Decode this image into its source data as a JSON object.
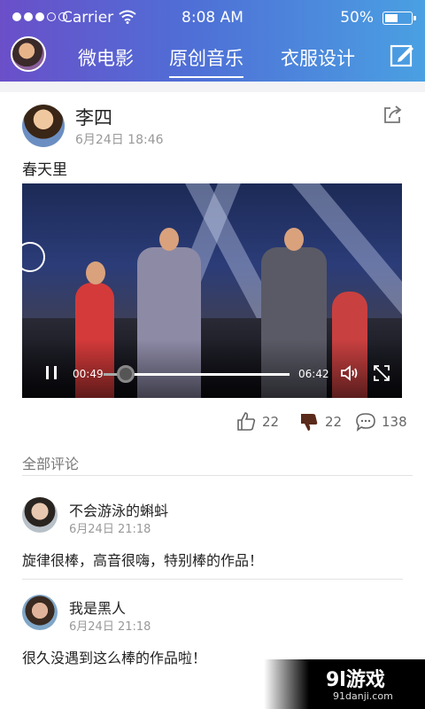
{
  "status_bar": {
    "carrier": "Carrier",
    "time": "8:08 AM",
    "battery": "50%",
    "battery_level": 0.5
  },
  "nav": {
    "tabs": [
      {
        "label": "微电影",
        "active": false
      },
      {
        "label": "原创音乐",
        "active": true
      },
      {
        "label": "衣服设计",
        "active": false
      }
    ],
    "edit_icon": "edit-icon"
  },
  "post": {
    "author": "李四",
    "time": "6月24日 18:46",
    "title": "春天里",
    "share_icon": "share-icon",
    "video": {
      "current_time": "00:49",
      "duration": "06:42",
      "progress": 0.12
    },
    "likes": "22",
    "dislikes": "22",
    "comments": "138"
  },
  "comments_section": {
    "label": "全部评论",
    "items": [
      {
        "name": "不会游泳的蝌蚪",
        "time": "6月24日 21:18",
        "text": "旋律很棒，高音很嗨，特别棒的作品！"
      },
      {
        "name": "我是黑人",
        "time": "6月24日 21:18",
        "text": "很久没遇到这么棒的作品啦！"
      }
    ]
  },
  "watermark": {
    "brand": "9l游戏",
    "domain": "91danji.com"
  },
  "colors": {
    "header_start": "#6a4fc9",
    "header_end": "#4aa0e2",
    "dislike_active": "#5a2a1a"
  }
}
